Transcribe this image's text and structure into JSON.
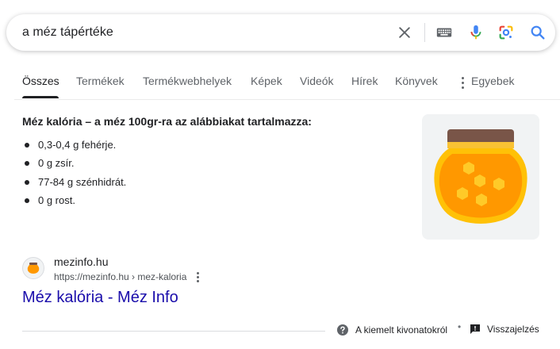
{
  "search": {
    "query": "a méz tápértéke"
  },
  "tabs": [
    {
      "label": "Összes",
      "active": true
    },
    {
      "label": "Termékek"
    },
    {
      "label": "Termékwebhelyek"
    },
    {
      "label": "Képek"
    },
    {
      "label": "Videók"
    },
    {
      "label": "Hírek"
    },
    {
      "label": "Könyvek"
    },
    {
      "label": "Egyebek"
    }
  ],
  "snippet": {
    "heading": "Méz kalória – a méz 100gr-ra az alábbiakat tartalmazza:",
    "items": [
      "0,3-0,4 g fehérje.",
      "0 g zsír.",
      "77-84 g szénhidrát.",
      "0 g rost."
    ]
  },
  "result": {
    "site_name": "mezinfo.hu",
    "url": "https://mezinfo.hu › mez-kaloria",
    "title": "Méz kalória - Méz Info"
  },
  "footer": {
    "about": "A kiemelt kivonatokról",
    "separator": "•",
    "feedback": "Visszajelzés"
  },
  "colors": {
    "link_title": "#1a0dab",
    "jar_lid": "#795548",
    "jar_body": "#ffb300",
    "jar_honey": "#ff9800",
    "comb": "#ffca28"
  },
  "icons": [
    "clear-icon",
    "keyboard-icon",
    "mic-icon",
    "lens-icon",
    "search-icon",
    "more-vert-icon",
    "help-icon",
    "feedback-icon",
    "honey-jar-icon"
  ]
}
